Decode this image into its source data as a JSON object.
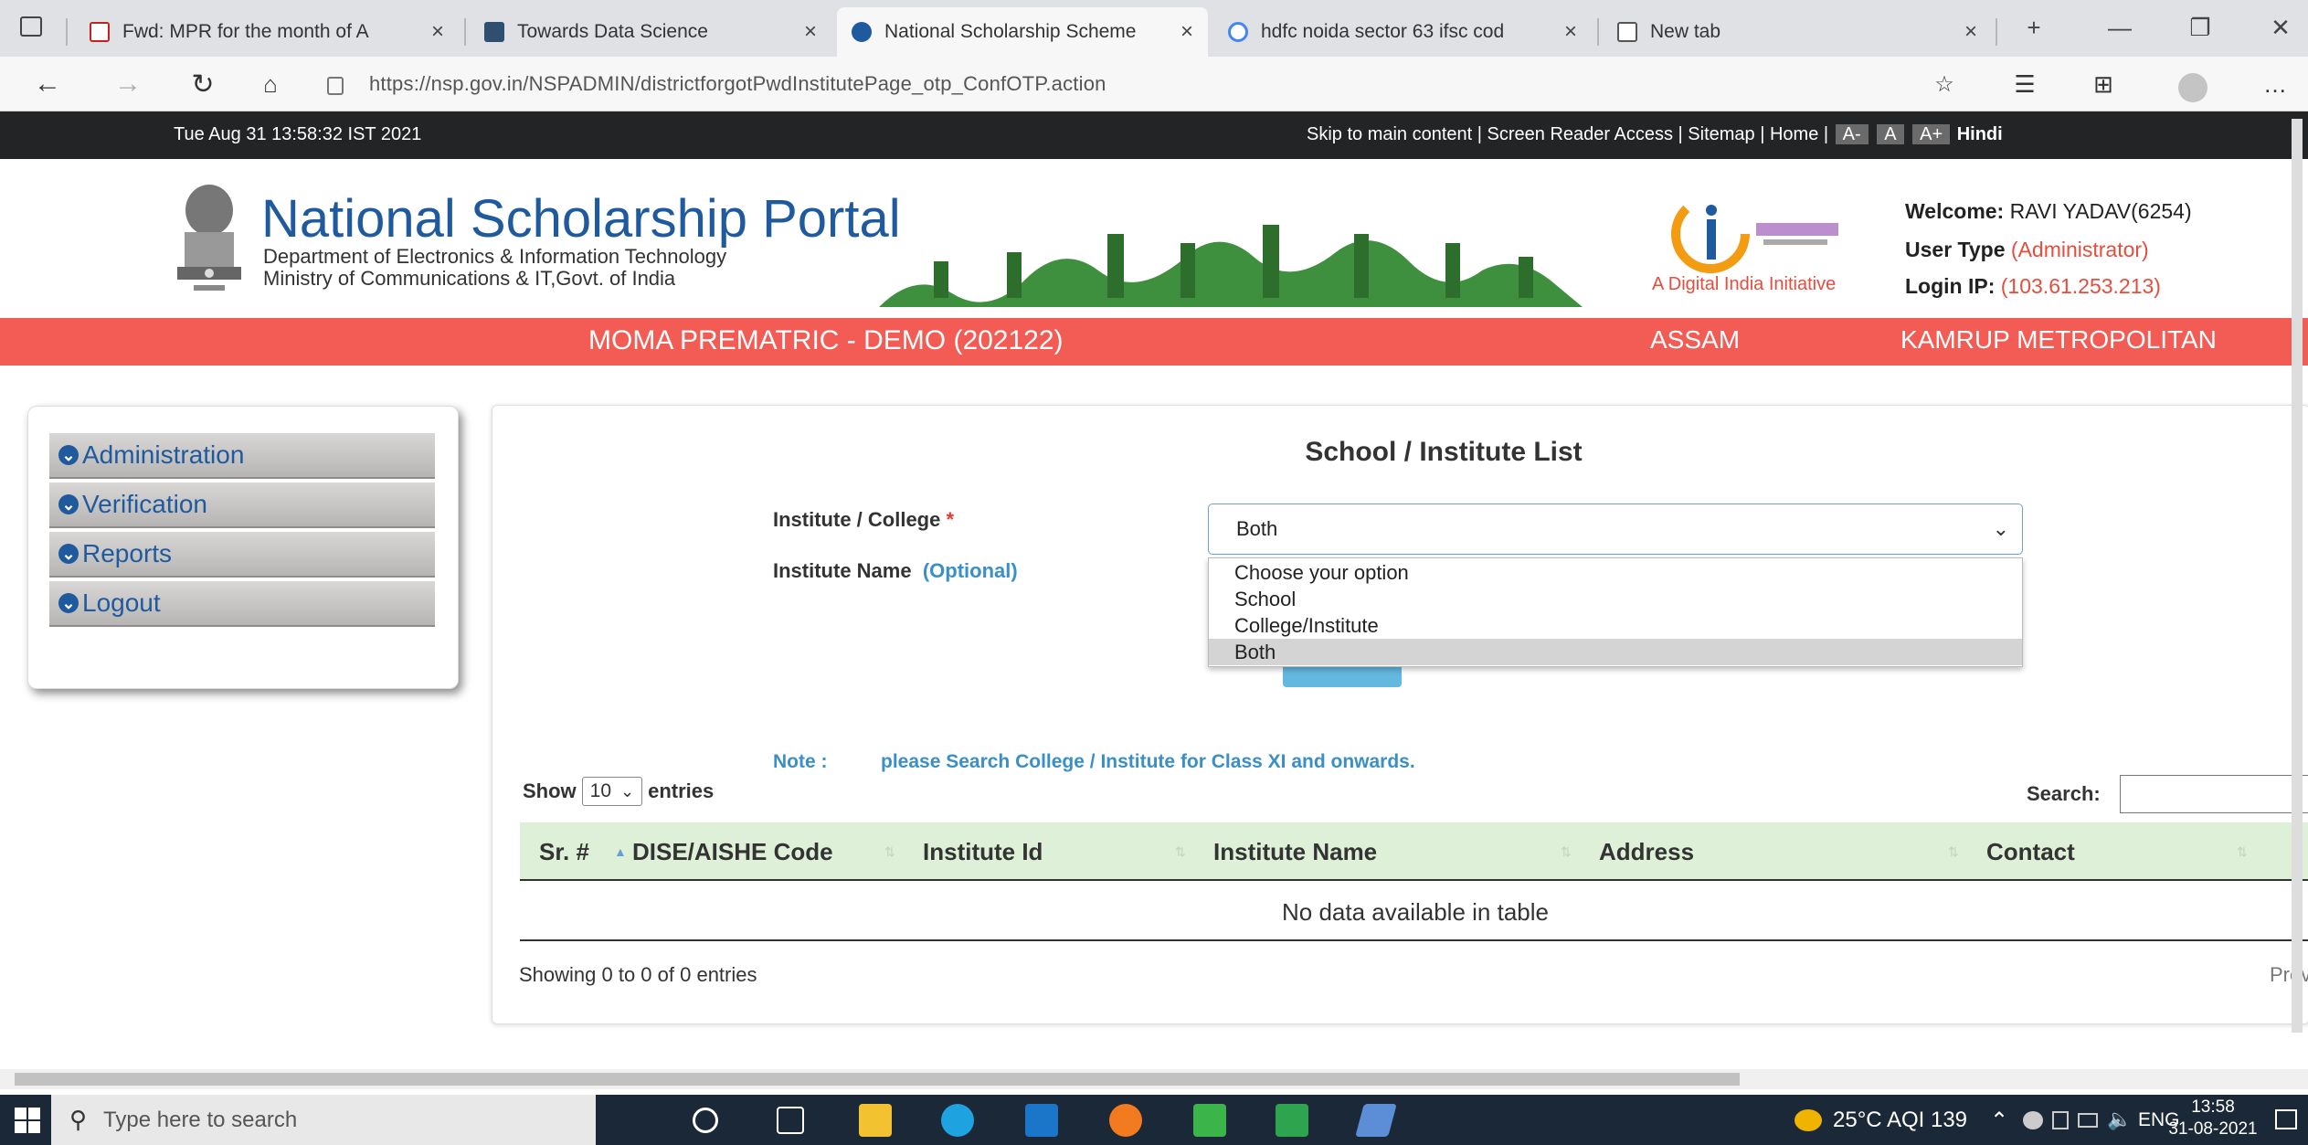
{
  "browser": {
    "tabs": [
      {
        "title": "Fwd: MPR for the month of A",
        "favicon_color": "#c5221f"
      },
      {
        "title": "Towards Data Science",
        "favicon_color": "#2f4f6f"
      },
      {
        "title": "National Scholarship Scheme",
        "favicon_color": "#1f5a9e"
      },
      {
        "title": "hdfc noida sector 63 ifsc cod",
        "favicon_color": "#4285f4"
      },
      {
        "title": "New tab",
        "favicon_color": "#555555"
      }
    ],
    "close_glyph": "×",
    "new_tab_glyph": "+",
    "url": "https://nsp.gov.in/NSPADMIN/districtforgotPwdInstitutePage_otp_ConfOTP.action",
    "controls": {
      "minimize": "—",
      "maximize": "❐",
      "close": "✕"
    },
    "nav_icons": [
      "back-icon",
      "forward-icon",
      "refresh-icon",
      "home-icon"
    ]
  },
  "site": {
    "datetime": "Tue Aug 31 13:58:32 IST 2021",
    "top_links": [
      "Skip to main content",
      "Screen Reader Access",
      "Sitemap",
      "Home"
    ],
    "font_sizes": [
      "A-",
      "A",
      "A+"
    ],
    "language": "Hindi",
    "title": "National Scholarship Portal",
    "department": "Department of Electronics & Information Technology",
    "ministry": "Ministry of Communications & IT,Govt. of India",
    "digital_india_tag": "A Digital India Initiative",
    "welcome_label": "Welcome:",
    "welcome_value": "RAVI YADAV(6254)",
    "user_type_label": "User Type",
    "user_type_value": "(Administrator)",
    "login_ip_label": "Login IP:",
    "login_ip_value": "(103.61.253.213)",
    "scheme": "MOMA PREMATRIC - DEMO (202122)",
    "state": "ASSAM",
    "district": "KAMRUP METROPOLITAN",
    "colors": {
      "brand_blue": "#1f5a9e",
      "band_red": "#f25c54",
      "table_header": "#dff0d8"
    }
  },
  "sidebar": {
    "items": [
      {
        "label": "Administration"
      },
      {
        "label": "Verification"
      },
      {
        "label": "Reports"
      },
      {
        "label": "Logout"
      }
    ]
  },
  "form": {
    "title": "School / Institute List",
    "institute_label": "Institute / College",
    "required_mark": "*",
    "name_label": "Institute Name",
    "name_optional": "(Optional)",
    "selected": "Both",
    "options": [
      "Choose your option",
      "School",
      "College/Institute",
      "Both"
    ],
    "note_label": "Note :",
    "note_text": "please Search College / Institute for Class XI and onwards."
  },
  "table": {
    "show_label": "Show",
    "entries_value": "10",
    "entries_label": "entries",
    "search_label": "Search:",
    "columns": [
      "Sr. #",
      "DISE/AISHE Code",
      "Institute Id",
      "Institute Name",
      "Address",
      "Contact"
    ],
    "empty_text": "No data available in table",
    "info": "Showing 0 to 0 of 0 entries",
    "prev_label": "Previ"
  },
  "taskbar": {
    "search_placeholder": "Type here to search",
    "weather": "25°C AQI 139",
    "lang": "ENG",
    "time": "13:58",
    "date": "31-08-2021"
  }
}
